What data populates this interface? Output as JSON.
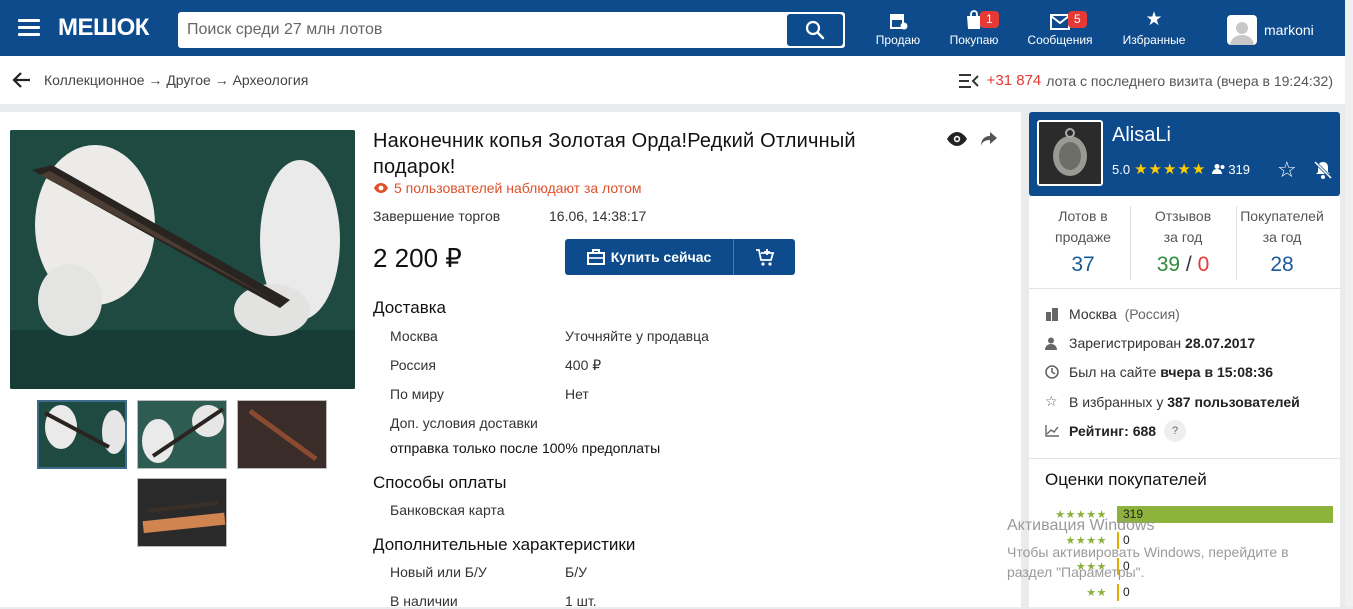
{
  "header": {
    "logo": "МЕШОК",
    "search_placeholder": "Поиск среди 27 млн лотов",
    "nav": [
      {
        "label": "Продаю",
        "badge": ""
      },
      {
        "label": "Покупаю",
        "badge": "1"
      },
      {
        "label": "Сообщения",
        "badge": "5"
      },
      {
        "label": "Избранные",
        "badge": ""
      }
    ],
    "username": "markoni"
  },
  "breadcrumb": {
    "text": "Коллекционное → Другое → Археология",
    "new_lots_count": "+31 874",
    "new_lots_text": "лота с последнего визита (вчера в 19:24:32)"
  },
  "lot": {
    "title": "Наконечник копья Золотая Орда!Редкий Отличный подарок!",
    "watchers": "5 пользователей наблюдают за лотом",
    "end_label": "Завершение торгов",
    "end_value": "16.06, 14:38:17",
    "price": "2 200 ₽",
    "buy_label": "Купить сейчас",
    "delivery_title": "Доставка",
    "delivery": [
      {
        "region": "Москва",
        "value": "Уточняйте у продавца"
      },
      {
        "region": "Россия",
        "value": "400 ₽"
      },
      {
        "region": "По миру",
        "value": "Нет"
      }
    ],
    "extra_delivery_label": "Доп. условия доставки",
    "extra_delivery_value": "отправка только после 100% предоплаты",
    "payment_title": "Способы оплаты",
    "payment_value": "Банковская карта",
    "extra_title": "Дополнительные характеристики",
    "characteristics": [
      {
        "name": "Новый или Б/У",
        "value": "Б/У"
      },
      {
        "name": "В наличии",
        "value": "1 шт."
      }
    ]
  },
  "seller": {
    "name": "AlisaLi",
    "rating": "5.0",
    "reviews_count": "319",
    "stats": [
      {
        "label1": "Лотов в",
        "label2": "продаже",
        "value": "37"
      },
      {
        "label1": "Отзывов",
        "label2": "за год",
        "value_pos": "39",
        "value_sep": "/",
        "value_neg": "0"
      },
      {
        "label1": "Покупателей",
        "label2": "за год",
        "value": "28"
      }
    ],
    "city": "Москва",
    "country": "(Россия)",
    "registered_label": "Зарегистрирован",
    "registered_value": "28.07.2017",
    "last_seen_label": "Был на сайте",
    "last_seen_value": "вчера в 15:08:36",
    "fav_label": "В избранных у",
    "fav_value": "387 пользователей",
    "rating_label": "Рейтинг:",
    "rating_value": "688",
    "help": "?",
    "ratings_title": "Оценки покупателей",
    "ratings": [
      {
        "stars": "★★★★★",
        "count": "319",
        "share": 1.0
      },
      {
        "stars": "★★★★",
        "count": "0",
        "share": 0
      },
      {
        "stars": "★★★",
        "count": "0",
        "share": 0
      },
      {
        "stars": "★★",
        "count": "0",
        "share": 0
      }
    ]
  },
  "windows": {
    "line1": "Активация Windows",
    "line2": "Чтобы активировать Windows, перейдите в раздел \"Параметры\"."
  },
  "colors": {
    "brand": "#0d4b8c",
    "accent_red": "#e53935",
    "positive": "#2e8b3a",
    "rating_bar": "#8db33c"
  }
}
